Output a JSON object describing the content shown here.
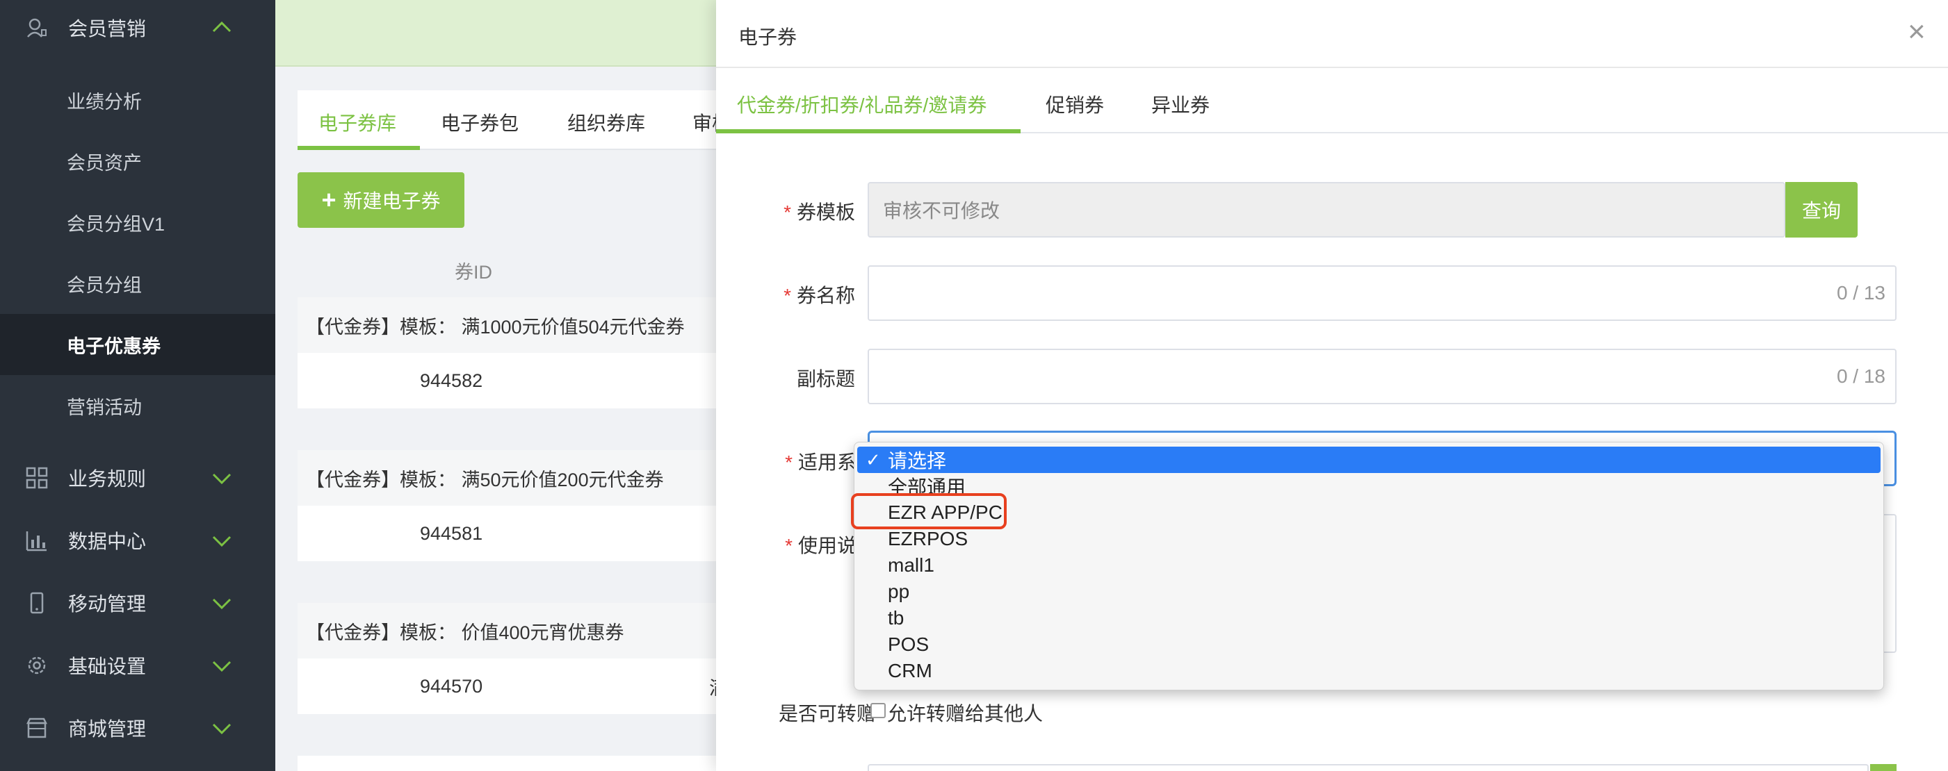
{
  "sidebar": {
    "section_marketing": "会员营销",
    "sub_items": [
      "业绩分析",
      "会员资产",
      "会员分组V1",
      "会员分组",
      "电子优惠券",
      "营销活动"
    ],
    "section_business_rules": "业务规则",
    "section_data_center": "数据中心",
    "section_mobile": "移动管理",
    "section_basic": "基础设置",
    "section_mall": "商城管理"
  },
  "main": {
    "tabs": [
      "电子券库",
      "电子券包",
      "组织券库",
      "审核"
    ],
    "new_button": "新建电子券",
    "new_button_icon": "+",
    "column_header": "券ID",
    "cards": [
      {
        "title": "【代金券】模板：  满1000元价值504元代金券",
        "id": "944582",
        "extra": ""
      },
      {
        "title": "【代金券】模板：  满50元价值200元代金券",
        "id": "944581",
        "extra": ""
      },
      {
        "title": "【代金券】模板：  价值400元宵优惠券",
        "id": "944570",
        "extra": "满"
      }
    ]
  },
  "dialog": {
    "title": "电子券",
    "close": "×",
    "tabs": [
      "代金券/折扣券/礼品券/邀请券",
      "促销券",
      "异业券"
    ],
    "required_mark": "*",
    "fields": {
      "template_label": "券模板",
      "template_value": "审核不可修改",
      "query_button": "查询",
      "name_label": "券名称",
      "name_counter": "0 / 13",
      "subtitle_label": "副标题",
      "subtitle_counter": "0 / 18",
      "system_label": "适用系统",
      "usage_label": "使用说明",
      "transfer_label": "是否可转赠",
      "transfer_checkbox": "允许转赠给其他人"
    },
    "dropdown": {
      "check": "✓",
      "options": [
        "请选择",
        "全部通用",
        "EZR APP/PC",
        "EZRPOS",
        "mall1",
        "pp",
        "tb",
        "POS",
        "CRM"
      ],
      "selected_index": 0,
      "highlighted_option": "EZR APP/PC"
    }
  },
  "colors": {
    "accent_green": "#7cc243",
    "button_green": "#8bc34a",
    "sidebar_bg": "#2b323b",
    "select_blue": "#2a7cf6",
    "highlight_red": "#e8401f"
  }
}
